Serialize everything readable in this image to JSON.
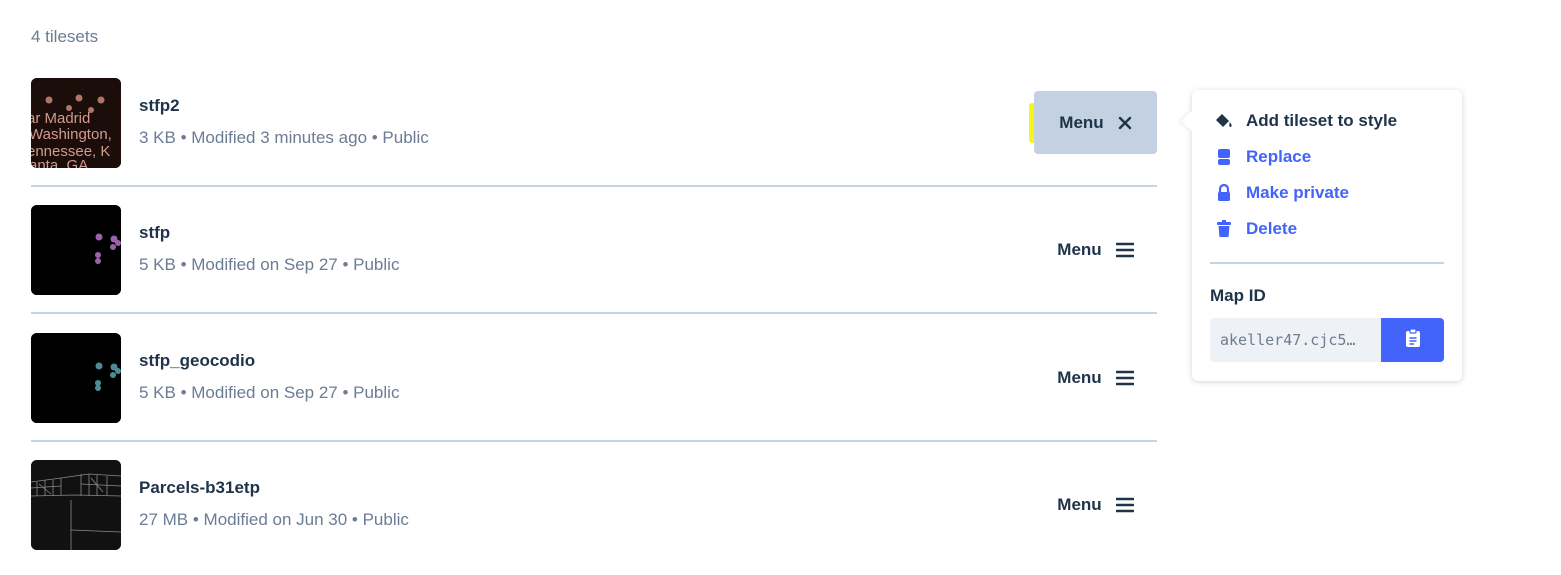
{
  "header": {
    "count_text": "4 tilesets"
  },
  "tilesets": [
    {
      "name": "stfp2",
      "meta": "3 KB • Modified 3 minutes ago • Public",
      "menu_label": "Menu",
      "menu_open": true,
      "thumb_text": [
        "ar Madrid",
        "Washington,",
        "ennessee, K",
        "anta, GA"
      ]
    },
    {
      "name": "stfp",
      "meta": "5 KB • Modified on Sep 27 • Public",
      "menu_label": "Menu",
      "menu_open": false
    },
    {
      "name": "stfp_geocodio",
      "meta": "5 KB • Modified on Sep 27 • Public",
      "menu_label": "Menu",
      "menu_open": false
    },
    {
      "name": "Parcels-b31etp",
      "meta": "27 MB • Modified on Jun 30 • Public",
      "menu_label": "Menu",
      "menu_open": false
    }
  ],
  "popover": {
    "items": [
      {
        "label": "Add tileset to style",
        "icon": "paint-bucket-icon"
      },
      {
        "label": "Replace",
        "icon": "replace-icon"
      },
      {
        "label": "Make private",
        "icon": "lock-icon"
      },
      {
        "label": "Delete",
        "icon": "trash-icon"
      }
    ],
    "map_id_label": "Map ID",
    "map_id_value": "akeller47.cjc5…"
  },
  "colors": {
    "accent": "#4264fb",
    "highlight": "#f3f719",
    "text": "#1f3349",
    "muted": "#6b7c93"
  }
}
